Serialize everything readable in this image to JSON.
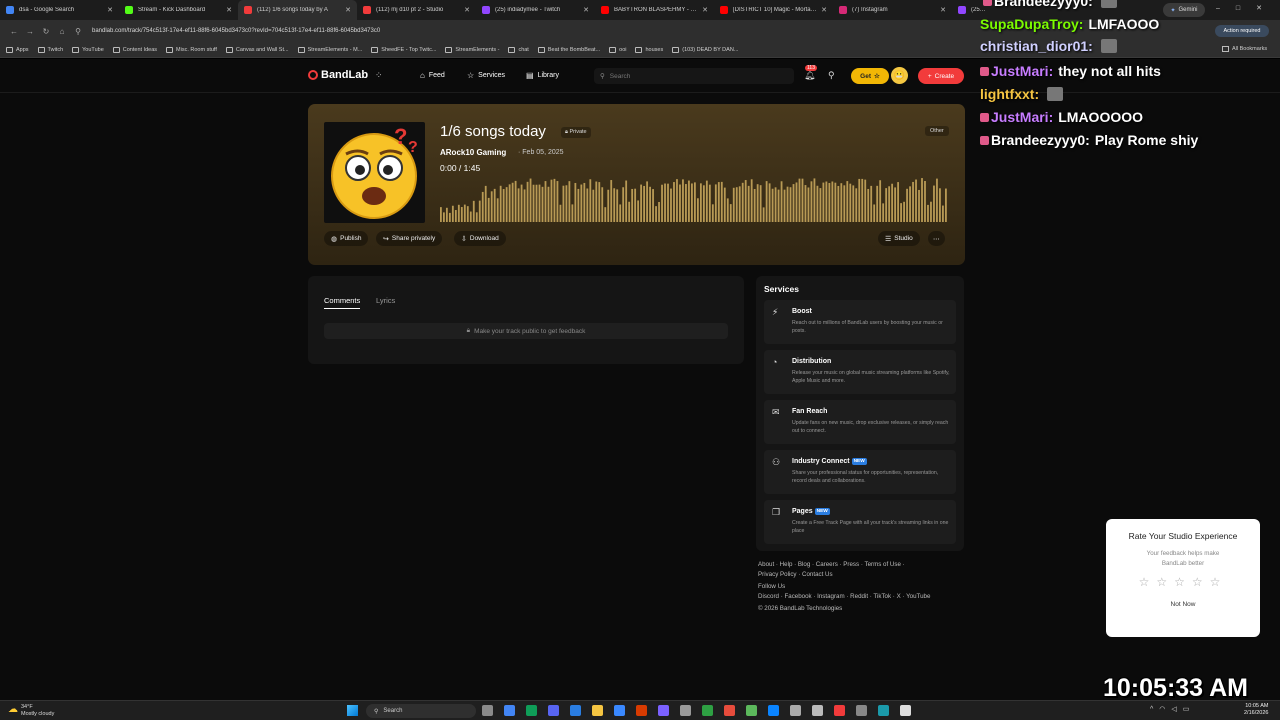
{
  "browser": {
    "tabs": [
      {
        "label": "dsa - Google Search",
        "color": "#4285f4"
      },
      {
        "label": "Stream - Kick Dashboard",
        "color": "#53fc18"
      },
      {
        "label": "(112) 1/6 songs today by A",
        "color": "#f23b3b"
      },
      {
        "label": "(112) mj d10 pt 2 - Studio",
        "color": "#f23b3b"
      },
      {
        "label": "(25) indiadymee - Twitch",
        "color": "#9146ff"
      },
      {
        "label": "BABYTRON BLASPEHMY - You",
        "color": "#ff0000"
      },
      {
        "label": "[DISTRICT 10] Magic - Mortal K",
        "color": "#ff0000"
      },
      {
        "label": "(7) Instagram",
        "color": "#d62976"
      },
      {
        "label": "(25) Twitch",
        "color": "#9146ff"
      }
    ],
    "gemini_label": "Gemini",
    "url": "bandlab.com/track/754c513f-17e4-ef11-88f6-6045bd3473c0?revId=704c513f-17e4-ef11-88f6-6045bd3473c0",
    "action_required": "Action required",
    "bookmarks": [
      "Apps",
      "Twitch",
      "YouTube",
      "Content Ideas",
      "Misc. Room stuff",
      "Canvas and Wall St...",
      "StreamElements - M...",
      "SheedFE - Top Twitc...",
      "StreamElements -",
      "chat",
      "Beat the BombBeat...",
      "ooi",
      "houses",
      "(103) DEAD BY DAN..."
    ],
    "all_bookmarks": "All Bookmarks"
  },
  "nav": {
    "logo": "BandLab",
    "feed": "Feed",
    "services": "Services",
    "library": "Library",
    "search_placeholder": "Search",
    "notification_count": "113",
    "get_label": "Get",
    "create_label": "Create"
  },
  "track": {
    "title": "1/6 songs today",
    "privacy": "Private",
    "genre": "Other",
    "artist": "ARock10 Gaming",
    "date": "· Feb 05, 2025",
    "time": "0:00 /  1:45",
    "actions": {
      "publish": "Publish",
      "share": "Share privately",
      "download": "Download",
      "studio": "Studio"
    }
  },
  "comments": {
    "tab_comments": "Comments",
    "tab_lyrics": "Lyrics",
    "note": "Make your track public to get feedback"
  },
  "services": {
    "heading": "Services",
    "items": [
      {
        "name": "Boost",
        "desc": "Reach out to millions of BandLab users by boosting your music or posts.",
        "badge": ""
      },
      {
        "name": "Distribution",
        "desc": "Release your music on global music streaming platforms like Spotify, Apple Music and more.",
        "badge": ""
      },
      {
        "name": "Fan Reach",
        "desc": "Update fans on new music, drop exclusive releases, or simply reach out to connect.",
        "badge": ""
      },
      {
        "name": "Industry Connect",
        "desc": "Share your professional status for opportunities, representation, record deals and collaborations.",
        "badge": "NEW"
      },
      {
        "name": "Pages",
        "desc": "Create a Free Track Page with all your track's streaming links in one place",
        "badge": "NEW"
      }
    ]
  },
  "footer": {
    "line1": "About · Help · Blog · Careers · Press · Terms of Use ·",
    "line2": "Privacy Policy · Contact Us",
    "follow": "Follow Us",
    "social": "Discord · Facebook · Instagram · Reddit · TikTok · X · YouTube",
    "copyright": "© 2026 BandLab Technologies"
  },
  "rating": {
    "title": "Rate Your Studio Experience",
    "subtitle": "Your feedback helps make BandLab better",
    "stars": "☆☆☆☆☆",
    "not_now": "Not Now"
  },
  "chat": [
    {
      "user": "Brandeezyyy0:",
      "msg": "",
      "color": "#ffffff"
    },
    {
      "user": "SupaDupaTroy:",
      "msg": "LMFAOOO",
      "color": "#7cfc00"
    },
    {
      "user": "christian_dior01:",
      "msg": "",
      "color": "#d0d0ff"
    },
    {
      "user": "JustMari:",
      "msg": "they not all hits",
      "color": "#c77dff"
    },
    {
      "user": "lightfxxt:",
      "msg": "",
      "color": "#f5c542"
    },
    {
      "user": "JustMari:",
      "msg": "LMAOOOOO",
      "color": "#c77dff"
    },
    {
      "user": "Brandeezyyy0:",
      "msg": "Play Rome shiy",
      "color": "#ffffff"
    }
  ],
  "clock_overlay": "10:05:33 AM",
  "taskbar": {
    "temp": "34°F",
    "weather": "Mostly cloudy",
    "search": "Search",
    "time": "10:05 AM",
    "date": "2/16/2026"
  },
  "colors": {
    "accent": "#f23b3b",
    "get_yellow": "#f2b705",
    "new_badge": "#2a7de1"
  }
}
